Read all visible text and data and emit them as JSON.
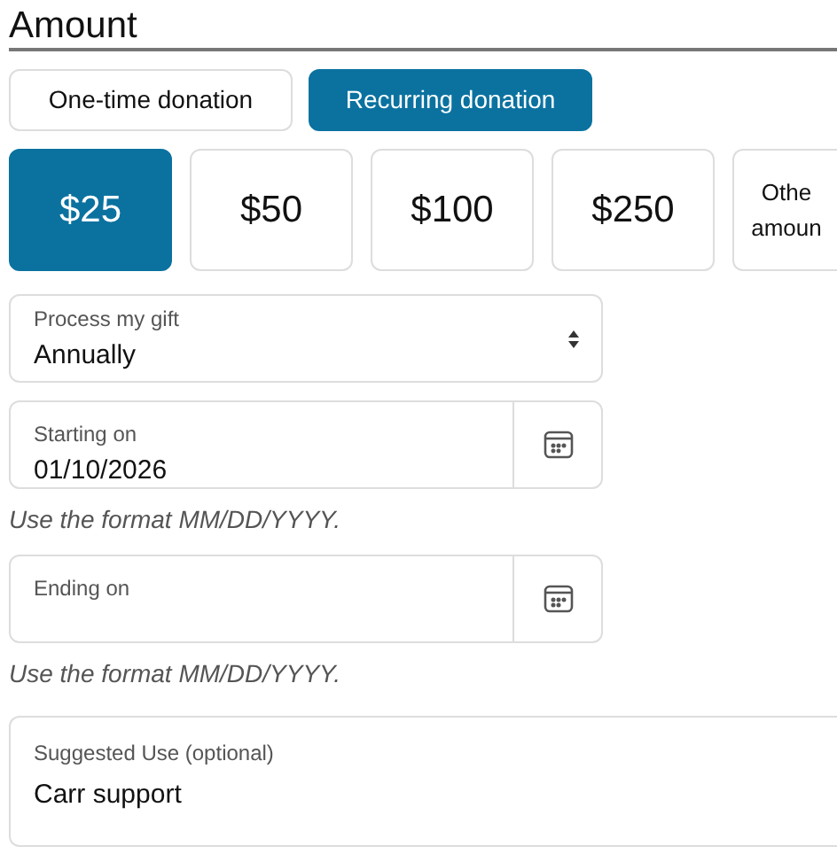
{
  "heading": "Amount",
  "frequency_tabs": [
    {
      "label": "One-time donation",
      "selected": false
    },
    {
      "label": "Recurring donation",
      "selected": true
    }
  ],
  "amounts": [
    {
      "lines": [
        "$25"
      ],
      "selected": true
    },
    {
      "lines": [
        "$50"
      ],
      "selected": false
    },
    {
      "lines": [
        "$100"
      ],
      "selected": false
    },
    {
      "lines": [
        "$250"
      ],
      "selected": false
    },
    {
      "lines": [
        "Othe",
        "amoun"
      ],
      "selected": false
    }
  ],
  "fields": [
    {
      "kind": "select",
      "label": "Process my gift",
      "value": "Annually"
    },
    {
      "kind": "date",
      "label": "Starting on",
      "value": "01/10/2026",
      "hint": "Use the format MM/DD/YYYY."
    },
    {
      "kind": "date",
      "label": "Ending on",
      "hint": "Use the format MM/DD/YYYY."
    },
    {
      "kind": "text",
      "label": "Suggested Use (optional)",
      "value": "Carr support"
    }
  ]
}
